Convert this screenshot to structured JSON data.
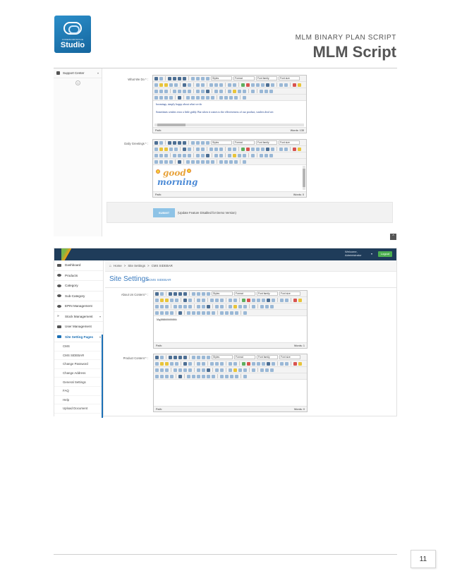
{
  "header": {
    "logo_small_text": "CODEWORKSPACE",
    "logo_text": "Studio",
    "subtitle": "MLM BINARY PLAN SCRIPT",
    "title": "MLM Script"
  },
  "shot1": {
    "sidebar_item": "Support Center",
    "collapse_label": "«",
    "what_we_do_label": "What We Do * :",
    "what_we_do_text_1": "boomings, simply happy about what we do",
    "what_we_do_text_2": "Sometimes wmlers error a little giddy. But when it comes to the effectiveness of our product, wmlers deal wit",
    "path_label": "Path:",
    "words_1": "Words: 135",
    "daily_greetings_label": "Daily Greetings * :",
    "greeting_word_1": "good",
    "greeting_word_2": "morning",
    "words_2": "Words: 0",
    "submit_label": "SUBMIT",
    "submit_note": "(Update Feature Disabled for Demo Version)",
    "scroll_top": "^"
  },
  "toolbar": {
    "styles": "Styles",
    "format": "Format",
    "font_family": "Font family",
    "font_size": "Font size"
  },
  "shot2": {
    "welcome_line_1": "Welcome,",
    "welcome_line_2": "Administrator",
    "logout": "Logout",
    "breadcrumb": [
      "Home",
      ">",
      "Site Settings",
      ">",
      "CMS SIDEBAR"
    ],
    "page_title": "Site Settings",
    "page_subtitle": "> CMS SIDEBAR",
    "sidebar": [
      "Dashboard",
      "Products",
      "Category",
      "Sub-Category",
      "EPIN Management",
      "Stock Management",
      "User Management",
      "Site Setting Pages"
    ],
    "submenu": [
      "CMS",
      "CMS SIDEBAR",
      "Change Password",
      "Change Address",
      "General Settings",
      "FAQ",
      "Help",
      "Upload Document"
    ],
    "about_us_label": "About Us Content * :",
    "about_us_text": "hhghhhhhhhhhhhh",
    "words_about": "Words: 1",
    "product_label": "Product Content * :",
    "words_product": "Words: 0",
    "path_label": "Path:"
  },
  "footer": {
    "page_number": "11"
  }
}
